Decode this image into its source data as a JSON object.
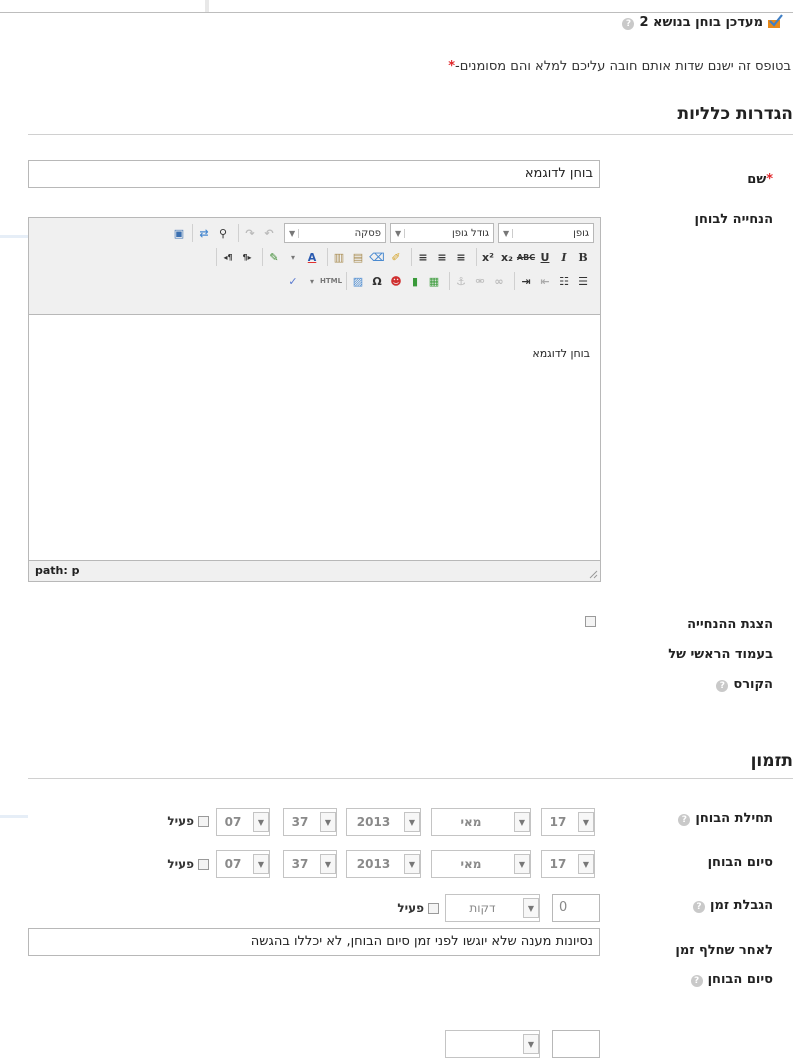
{
  "page_title": "מעדכן בוחן בנושא 2",
  "required_note": "בטופס זה ישנם שדות אותם חובה עליכם למלא והם מסומנים-",
  "required_star": "*",
  "sections": {
    "general": "הגדרות כלליות",
    "timing": "תזמון"
  },
  "fields": {
    "name_label": "שם",
    "name_value": "בוחן לדוגמא",
    "intro_label": "הנחייה לבוחן",
    "show_intro_label_1": "הצגת ההנחייה",
    "show_intro_label_2": "בעמוד הראשי של",
    "show_intro_label_3": "הקורס",
    "open_label": "תחילת הבוחן",
    "close_label": "סיום הבוחן",
    "time_limit_label": "הגבלת זמן",
    "after_close_label_1": "לאחר שחלף זמן",
    "after_close_label_2": "סיום הבוחן",
    "after_close_value": "נסיונות מענה שלא יוגשו לפני זמן סיום הבוחן, לא יכללו בהגשה"
  },
  "editor": {
    "font_select": "גופן",
    "size_select": "גודל גופן",
    "format_select": "פסקה",
    "content": "בוחן לדוגמא",
    "path": "path: p"
  },
  "date_open": {
    "day": "17",
    "month": "מאי",
    "year": "2013",
    "hour": "37",
    "minute": "07",
    "enabled": "פעיל"
  },
  "date_close": {
    "day": "17",
    "month": "מאי",
    "year": "2013",
    "hour": "37",
    "minute": "07",
    "enabled": "פעיל"
  },
  "time_limit": {
    "value": "0",
    "unit": "דקות",
    "enabled": "פעיל"
  },
  "colors": {
    "required_star": "#e0262a",
    "check_icon": "#e8891a"
  },
  "icons": [
    "check-icon",
    "help-icon",
    "dropdown-arrow-icon"
  ]
}
